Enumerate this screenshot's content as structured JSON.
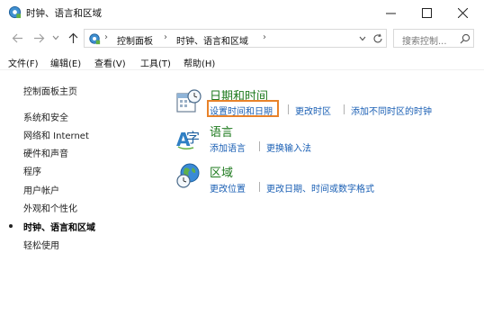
{
  "window": {
    "title": "时钟、语言和区域",
    "controls": {
      "minimize": "—",
      "maximize": "☐",
      "close": "✕"
    }
  },
  "nav": {
    "back_icon": "arrow-left-icon",
    "forward_icon": "arrow-right-icon",
    "up_icon": "arrow-up-icon",
    "breadcrumb": [
      "控制面板",
      "时钟、语言和区域"
    ],
    "search_placeholder": "搜索控制..."
  },
  "menu": [
    "文件(F)",
    "编辑(E)",
    "查看(V)",
    "工具(T)",
    "帮助(H)"
  ],
  "sidebar": {
    "items": [
      {
        "label": "控制面板主页"
      },
      {
        "label": "系统和安全"
      },
      {
        "label": "网络和 Internet"
      },
      {
        "label": "硬件和声音"
      },
      {
        "label": "程序"
      },
      {
        "label": "用户帐户"
      },
      {
        "label": "外观和个性化"
      },
      {
        "label": "时钟、语言和区域",
        "current": true
      },
      {
        "label": "轻松使用"
      }
    ]
  },
  "categories": [
    {
      "title": "日期和时间",
      "icon": "calendar-clock-icon",
      "links": [
        "设置时间和日期",
        "更改时区",
        "添加不同时区的时钟"
      ]
    },
    {
      "title": "语言",
      "icon": "language-icon",
      "links": [
        "添加语言",
        "更换输入法"
      ]
    },
    {
      "title": "区域",
      "icon": "globe-clock-icon",
      "links": [
        "更改位置",
        "更改日期、时间或数字格式"
      ]
    }
  ],
  "colors": {
    "category_title": "#1e7a1e",
    "link": "#1a5fb4",
    "highlight_box": "#e8822a"
  }
}
